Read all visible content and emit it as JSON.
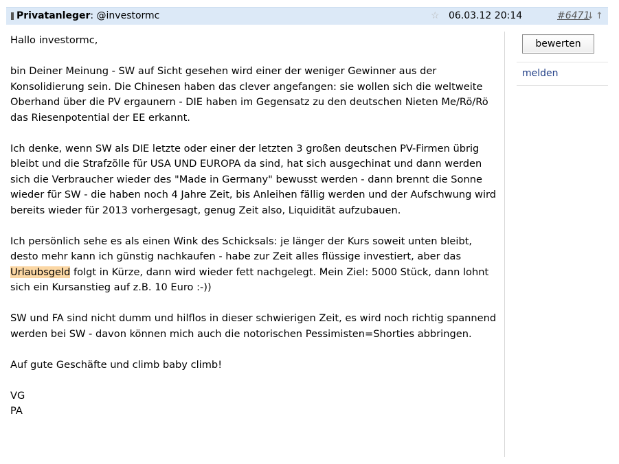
{
  "header": {
    "author_label": "Privatanleger",
    "author_reply_to": ": @investormc",
    "date": "06.03.12 20:14",
    "post_number": "#6471",
    "icons": [
      "author-icon",
      "star-icon",
      "arrow-down-icon",
      "arrow-up-icon"
    ],
    "star_symbol": "☆",
    "arrow_down_symbol": "↓",
    "arrow_up_symbol": "↑"
  },
  "body": {
    "greeting": "Hallo investormc,",
    "p1": "bin Deiner Meinung - SW auf Sicht gesehen wird einer der weniger Gewinner aus der Konsolidierung sein. Die Chinesen haben das clever angefangen: sie wollen sich die weltweite Oberhand über die PV ergaunern - DIE haben im Gegensatz zu den deutschen Nieten Me/Rö/Rö das Riesenpotential der EE erkannt.",
    "p2": "Ich denke, wenn SW als DIE letzte oder einer der letzten 3 großen deutschen PV-Firmen übrig bleibt und die Strafzölle für USA UND EUROPA da sind, hat sich ausgechinat und dann werden sich die Verbraucher wieder des \"Made in Germany\" bewusst werden - dann brennt die Sonne wieder für SW - die haben noch 4 Jahre Zeit, bis Anleihen fällig werden und der Aufschwung wird bereits wieder für 2013 vorhergesagt, genug Zeit also, Liquidität aufzubauen.",
    "p3_before": "Ich persönlich sehe es als einen Wink des Schicksals: je länger der Kurs soweit unten bleibt, desto mehr kann ich günstig nachkaufen - habe zur Zeit alles flüssige investiert, aber das ",
    "p3_highlight": "Urlaubsgeld",
    "p3_after": " folgt in Kürze, dann wird wieder fett nachgelegt. Mein Ziel: 5000 Stück, dann lohnt sich ein Kursanstieg auf z.B. 10 Euro  :-))",
    "p4": "SW und FA sind nicht dumm und hilflos in dieser schwierigen Zeit, es wird noch richtig spannend werden bei SW - davon können mich auch die notorischen Pessimisten=Shorties abbringen.",
    "p5": "Auf gute Geschäfte und climb baby climb!",
    "sign1": "VG",
    "sign2": "PA"
  },
  "sidebar": {
    "rate_label": "bewerten",
    "report_label": "melden"
  },
  "colors": {
    "header_bg": "#dce9f7",
    "highlight": "#fbd7a4",
    "link": "#1f3d86"
  }
}
